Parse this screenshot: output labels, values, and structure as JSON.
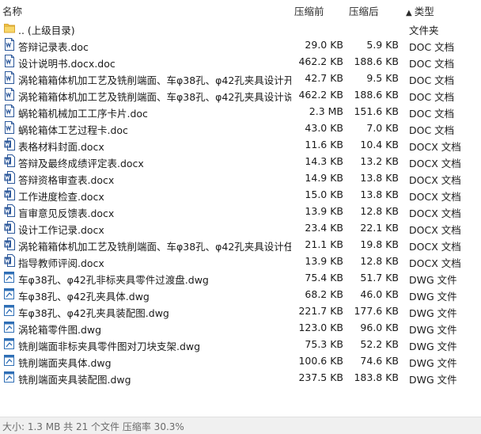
{
  "columns": {
    "name": "名称",
    "compressed": "压缩前",
    "size": "压缩后",
    "type": "类型",
    "sort_arrow": "▲"
  },
  "files": [
    {
      "name": ".. (上级目录)",
      "compressed": "",
      "size": "",
      "type": "文件夹",
      "icon": "folder-icon"
    },
    {
      "name": "答辩记录表.doc",
      "compressed": "29.0 KB",
      "size": "5.9 KB",
      "type": "DOC 文档",
      "icon": "doc-icon"
    },
    {
      "name": "设计说明书.docx.doc",
      "compressed": "462.2 KB",
      "size": "188.6 KB",
      "type": "DOC 文档",
      "icon": "doc-icon"
    },
    {
      "name": "涡轮箱箱体机加工艺及铣削端面、车φ38孔、φ42孔夹具设计开...",
      "compressed": "42.7 KB",
      "size": "9.5 KB",
      "type": "DOC 文档",
      "icon": "doc-icon"
    },
    {
      "name": "涡轮箱箱体机加工艺及铣削端面、车φ38孔、φ42孔夹具设计说...",
      "compressed": "462.2 KB",
      "size": "188.6 KB",
      "type": "DOC 文档",
      "icon": "doc-icon"
    },
    {
      "name": "蜗轮箱机械加工工序卡片.doc",
      "compressed": "2.3 MB",
      "size": "151.6 KB",
      "type": "DOC 文档",
      "icon": "doc-icon"
    },
    {
      "name": "蜗轮箱体工艺过程卡.doc",
      "compressed": "43.0 KB",
      "size": "7.0 KB",
      "type": "DOC 文档",
      "icon": "doc-icon"
    },
    {
      "name": "表格材料封面.docx",
      "compressed": "11.6 KB",
      "size": "10.4 KB",
      "type": "DOCX 文档",
      "icon": "docx-icon"
    },
    {
      "name": "答辩及最终成绩评定表.docx",
      "compressed": "14.3 KB",
      "size": "13.2 KB",
      "type": "DOCX 文档",
      "icon": "docx-icon"
    },
    {
      "name": "答辩资格审查表.docx",
      "compressed": "14.9 KB",
      "size": "13.8 KB",
      "type": "DOCX 文档",
      "icon": "docx-icon"
    },
    {
      "name": "工作进度检查.docx",
      "compressed": "15.0 KB",
      "size": "13.8 KB",
      "type": "DOCX 文档",
      "icon": "docx-icon"
    },
    {
      "name": "盲审意见反馈表.docx",
      "compressed": "13.9 KB",
      "size": "12.8 KB",
      "type": "DOCX 文档",
      "icon": "docx-icon"
    },
    {
      "name": "设计工作记录.docx",
      "compressed": "23.4 KB",
      "size": "22.1 KB",
      "type": "DOCX 文档",
      "icon": "docx-icon"
    },
    {
      "name": "涡轮箱箱体机加工艺及铣削端面、车φ38孔、φ42孔夹具设计任...",
      "compressed": "21.1 KB",
      "size": "19.8 KB",
      "type": "DOCX 文档",
      "icon": "docx-icon"
    },
    {
      "name": "指导教师评阅.docx",
      "compressed": "13.9 KB",
      "size": "12.8 KB",
      "type": "DOCX 文档",
      "icon": "docx-icon"
    },
    {
      "name": "车φ38孔、φ42孔非标夹具零件过渡盘.dwg",
      "compressed": "75.4 KB",
      "size": "51.7 KB",
      "type": "DWG 文件",
      "icon": "dwg-icon"
    },
    {
      "name": "车φ38孔、φ42孔夹具体.dwg",
      "compressed": "68.2 KB",
      "size": "46.0 KB",
      "type": "DWG 文件",
      "icon": "dwg-icon"
    },
    {
      "name": "车φ38孔、φ42孔夹具装配图.dwg",
      "compressed": "221.7 KB",
      "size": "177.6 KB",
      "type": "DWG 文件",
      "icon": "dwg-icon"
    },
    {
      "name": "涡轮箱零件图.dwg",
      "compressed": "123.0 KB",
      "size": "96.0 KB",
      "type": "DWG 文件",
      "icon": "dwg-icon"
    },
    {
      "name": "铣削端面非标夹具零件图对刀块支架.dwg",
      "compressed": "75.3 KB",
      "size": "52.2 KB",
      "type": "DWG 文件",
      "icon": "dwg-icon"
    },
    {
      "name": "铣削端面夹具体.dwg",
      "compressed": "100.6 KB",
      "size": "74.6 KB",
      "type": "DWG 文件",
      "icon": "dwg-icon"
    },
    {
      "name": "铣削端面夹具装配图.dwg",
      "compressed": "237.5 KB",
      "size": "183.8 KB",
      "type": "DWG 文件",
      "icon": "dwg-icon"
    }
  ],
  "status": {
    "text": "大小: 1.3 MB 共 21 个文件 压缩率 30.3%"
  },
  "colors": {
    "doc_blue": "#2b579a",
    "folder_yellow": "#f3c64d",
    "dwg_blue": "#2f6fb6"
  }
}
